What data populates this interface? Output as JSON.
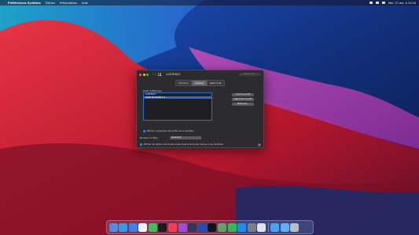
{
  "menubar": {
    "app_name": "Préférences Système",
    "items": [
      "Édition",
      "Présentation",
      "Aide"
    ],
    "clock": "Mer. 27 avr. à 12:04"
  },
  "window": {
    "title": "LGSTEK07",
    "search_placeholder": "Rechercher",
    "tabs": [
      {
        "label": "Moniteur",
        "active": false
      },
      {
        "label": "Couleur",
        "active": true
      },
      {
        "label": "Night Shift",
        "active": false
      }
    ],
    "profile_section_label": "Profil d'affichage :",
    "profiles": [
      {
        "label": "LGSTEK07",
        "selected": false
      },
      {
        "label": "sRGB IEC61966-2.1",
        "selected": true
      }
    ],
    "side_buttons": [
      "Ouvrir le profil",
      "Supprimer le profil",
      "Étalonner..."
    ],
    "show_profiles_checkbox": "Afficher uniquement les profils de ce moniteur",
    "monitor_label": "Moniteur Air Play :",
    "monitor_select": "Désactivé",
    "mirroring_checkbox": "Afficher les options de recopie vidéo dans la barre des menus si ces dernières",
    "help": "?"
  },
  "colors": {
    "accent": "#2d6cdf",
    "window_bg": "#2c2c2e"
  },
  "dock": {
    "icons": [
      {
        "name": "finder-icon",
        "color": "#4a8fe7"
      },
      {
        "name": "safari-icon",
        "color": "#2a9ef0"
      },
      {
        "name": "mail-icon",
        "color": "#3b83f0"
      },
      {
        "name": "photos-icon",
        "color": "#f3f3f3"
      },
      {
        "name": "messages-icon",
        "color": "#37c44a"
      },
      {
        "name": "tv-icon",
        "color": "#1b1b1b"
      },
      {
        "name": "music-icon",
        "color": "#fa3c55"
      },
      {
        "name": "podcasts-icon",
        "color": "#9a4ee0"
      },
      {
        "name": "lyric-icon",
        "color": "#2f3a58"
      },
      {
        "name": "keynote-icon",
        "color": "#1f4fb3"
      },
      {
        "name": "g-hub-icon",
        "color": "#101214"
      },
      {
        "name": "maps-icon",
        "color": "#5aa85e"
      },
      {
        "name": "facetime-icon",
        "color": "#2dbe52"
      },
      {
        "name": "appstore-icon",
        "color": "#1f8cf5"
      },
      {
        "name": "system-preferences-icon",
        "color": "#7d7d82"
      },
      {
        "name": "activity-monitor-icon",
        "color": "#e4e4e6"
      },
      {
        "name": "downloads-folder-icon",
        "color": "#47a3f0"
      },
      {
        "name": "documents-folder-icon",
        "color": "#5cb2f4"
      },
      {
        "name": "trash-icon",
        "color": "#b8bcc4"
      }
    ]
  }
}
